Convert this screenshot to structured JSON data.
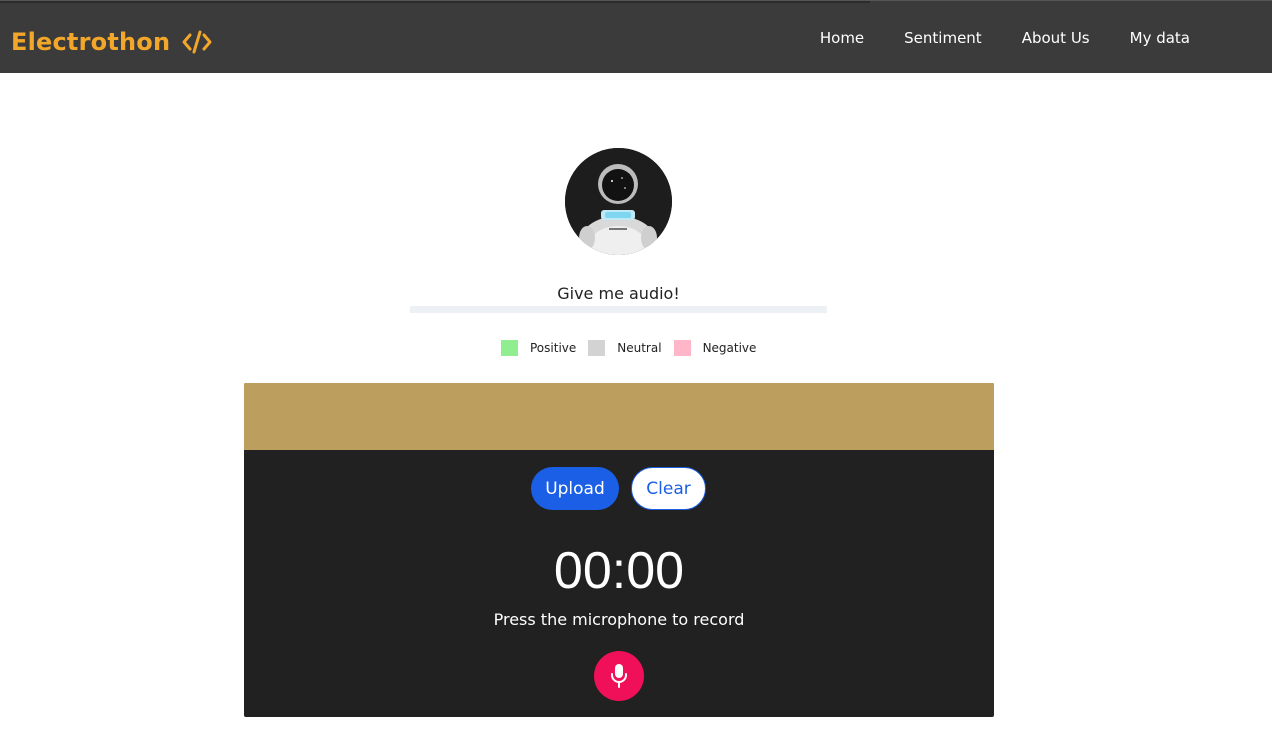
{
  "navbar": {
    "brand": "Electrothon",
    "brand_icon": "code-icon",
    "links": [
      "Home",
      "Sentiment",
      "About Us",
      "My data"
    ],
    "brand_color": "#f3a72a",
    "background": "#3b3b3b"
  },
  "main": {
    "avatar_icon": "astronaut-avatar",
    "prompt": "Give me audio!",
    "legend": [
      {
        "label": "Positive",
        "color": "#90ee90"
      },
      {
        "label": "Neutral",
        "color": "#d3d3d3"
      },
      {
        "label": "Negative",
        "color": "#ffb6c9"
      }
    ]
  },
  "recorder": {
    "band_color": "#bc9e5f",
    "upload_label": "Upload",
    "clear_label": "Clear",
    "timer": "00:00",
    "hint": "Press the microphone to record",
    "mic_icon": "microphone-icon",
    "mic_color": "#f0105a"
  }
}
